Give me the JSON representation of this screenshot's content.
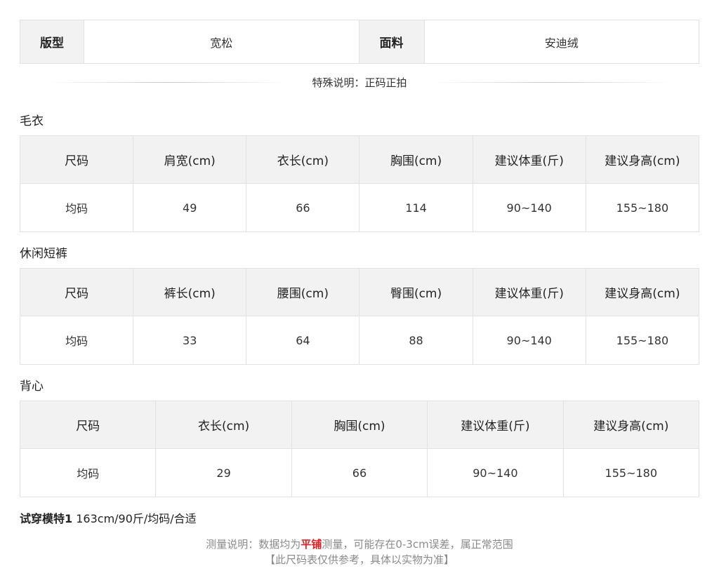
{
  "attributes": {
    "fit_label": "版型",
    "fit_value": "宽松",
    "fabric_label": "面料",
    "fabric_value": "安迪绒"
  },
  "note": "特殊说明：正码正拍",
  "sections": [
    {
      "title": "毛衣",
      "headers": [
        "尺码",
        "肩宽(cm)",
        "衣长(cm)",
        "胸围(cm)",
        "建议体重(斤)",
        "建议身高(cm)"
      ],
      "row": [
        "均码",
        "49",
        "66",
        "114",
        "90~140",
        "155~180"
      ]
    },
    {
      "title": "休闲短裤",
      "headers": [
        "尺码",
        "裤长(cm)",
        "腰围(cm)",
        "臀围(cm)",
        "建议体重(斤)",
        "建议身高(cm)"
      ],
      "row": [
        "均码",
        "33",
        "64",
        "88",
        "90~140",
        "155~180"
      ]
    },
    {
      "title": "背心",
      "headers": [
        "尺码",
        "衣长(cm)",
        "胸围(cm)",
        "建议体重(斤)",
        "建议身高(cm)"
      ],
      "row": [
        "均码",
        "29",
        "66",
        "90~140",
        "155~180"
      ]
    }
  ],
  "model": {
    "label": "试穿模特1",
    "value": " 163cm/90斤/均码/合适"
  },
  "footer": {
    "line1_prefix": "测量说明：数据均为",
    "line1_highlight": "平铺",
    "line1_suffix": "测量，可能存在0-3cm误差，属正常范围",
    "line2": "【此尺码表仅供参考，具体以实物为准】"
  },
  "colors": {
    "header_bg": "#f2f2f2",
    "border": "#e2e2e2",
    "highlight": "#e02020",
    "footer_text": "#8a8a8a"
  }
}
